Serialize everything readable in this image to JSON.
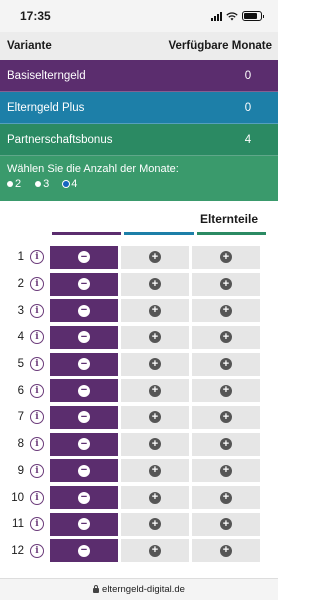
{
  "status_bar": {
    "time": "17:35"
  },
  "header": {
    "col_variant": "Variante",
    "col_months": "Verfügbare Monate"
  },
  "variants": [
    {
      "name": "Basiselterngeld",
      "months": "0",
      "color": "#5b2d6e"
    },
    {
      "name": "Elterngeld Plus",
      "months": "0",
      "color": "#1d7fa8"
    },
    {
      "name": "Partnerschaftsbonus",
      "months": "4",
      "color": "#2b8a63"
    }
  ],
  "chooser": {
    "label": "Wählen Sie die Anzahl der Monate:",
    "options": [
      "2",
      "3",
      "4"
    ],
    "selected": "4"
  },
  "grid": {
    "title": "Elternteile",
    "bar_colors": [
      "#5b2d6e",
      "#1d7fa8",
      "#2b8a63"
    ],
    "rows": [
      "1",
      "2",
      "3",
      "4",
      "5",
      "6",
      "7",
      "8",
      "9",
      "10",
      "11",
      "12"
    ],
    "minus_symbol": "−",
    "plus_symbol": "+",
    "info_symbol": "i"
  },
  "url_bar": {
    "url": "elterngeld-digital.de"
  }
}
